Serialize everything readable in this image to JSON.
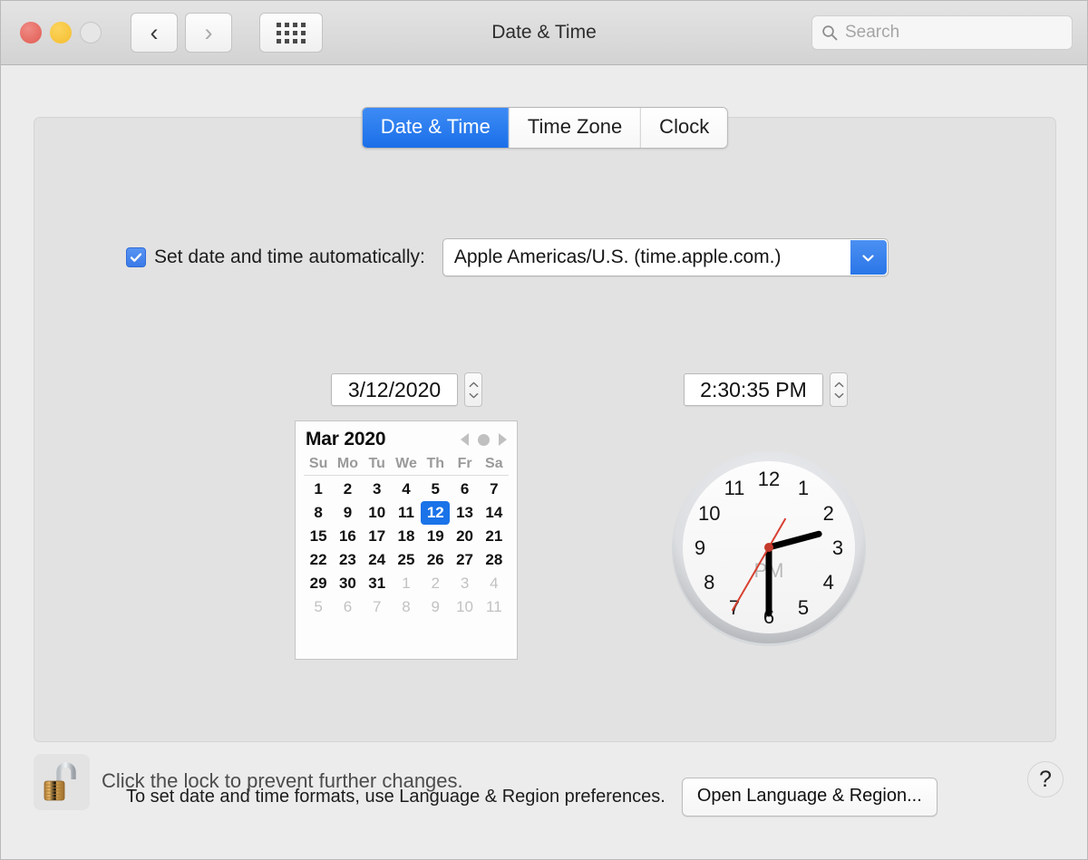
{
  "window": {
    "title": "Date & Time",
    "traffic_lights": [
      "close",
      "minimize",
      "zoom"
    ]
  },
  "toolbar": {
    "back_icon": "chevron-left-icon",
    "forward_icon": "chevron-right-icon",
    "showall_icon": "grid-dots-icon"
  },
  "search": {
    "placeholder": "Search",
    "value": "",
    "icon": "search-icon"
  },
  "tabs": [
    {
      "label": "Date & Time",
      "active": true
    },
    {
      "label": "Time Zone",
      "active": false
    },
    {
      "label": "Clock",
      "active": false
    }
  ],
  "auto_row": {
    "checkbox_checked": true,
    "checkbox_icon": "checkmark-icon",
    "label": "Set date and time automatically:",
    "server": "Apple Americas/U.S. (time.apple.com.)",
    "dropdown_icon": "chevron-down-icon"
  },
  "date_field": {
    "value": "3/12/2020",
    "stepper_up_icon": "stepper-up-icon",
    "stepper_down_icon": "stepper-down-icon"
  },
  "time_field": {
    "value": "2:30:35 PM",
    "stepper_up_icon": "stepper-up-icon",
    "stepper_down_icon": "stepper-down-icon"
  },
  "calendar": {
    "title": "Mar 2020",
    "prev_icon": "triangle-left-icon",
    "today_icon": "circle-dot-icon",
    "next_icon": "triangle-right-icon",
    "weekdays": [
      "Su",
      "Mo",
      "Tu",
      "We",
      "Th",
      "Fr",
      "Sa"
    ],
    "selected_day": 12,
    "weeks": [
      [
        {
          "d": "1",
          "o": false
        },
        {
          "d": "2",
          "o": false
        },
        {
          "d": "3",
          "o": false
        },
        {
          "d": "4",
          "o": false
        },
        {
          "d": "5",
          "o": false
        },
        {
          "d": "6",
          "o": false
        },
        {
          "d": "7",
          "o": false
        }
      ],
      [
        {
          "d": "8",
          "o": false
        },
        {
          "d": "9",
          "o": false
        },
        {
          "d": "10",
          "o": false
        },
        {
          "d": "11",
          "o": false
        },
        {
          "d": "12",
          "o": false,
          "sel": true
        },
        {
          "d": "13",
          "o": false
        },
        {
          "d": "14",
          "o": false
        }
      ],
      [
        {
          "d": "15",
          "o": false
        },
        {
          "d": "16",
          "o": false
        },
        {
          "d": "17",
          "o": false
        },
        {
          "d": "18",
          "o": false
        },
        {
          "d": "19",
          "o": false
        },
        {
          "d": "20",
          "o": false
        },
        {
          "d": "21",
          "o": false
        }
      ],
      [
        {
          "d": "22",
          "o": false
        },
        {
          "d": "23",
          "o": false
        },
        {
          "d": "24",
          "o": false
        },
        {
          "d": "25",
          "o": false
        },
        {
          "d": "26",
          "o": false
        },
        {
          "d": "27",
          "o": false
        },
        {
          "d": "28",
          "o": false
        }
      ],
      [
        {
          "d": "29",
          "o": false
        },
        {
          "d": "30",
          "o": false
        },
        {
          "d": "31",
          "o": false
        },
        {
          "d": "1",
          "o": true
        },
        {
          "d": "2",
          "o": true
        },
        {
          "d": "3",
          "o": true
        },
        {
          "d": "4",
          "o": true
        }
      ],
      [
        {
          "d": "5",
          "o": true
        },
        {
          "d": "6",
          "o": true
        },
        {
          "d": "7",
          "o": true
        },
        {
          "d": "8",
          "o": true
        },
        {
          "d": "9",
          "o": true
        },
        {
          "d": "10",
          "o": true
        },
        {
          "d": "11",
          "o": true
        }
      ]
    ]
  },
  "clock": {
    "hours": [
      "12",
      "1",
      "2",
      "3",
      "4",
      "5",
      "6",
      "7",
      "8",
      "9",
      "10",
      "11"
    ],
    "meridiem": "PM",
    "hour_value": 2,
    "minute_value": 30,
    "second_value": 35,
    "hand_color": "#000000",
    "second_hand_color": "#d84030"
  },
  "note": {
    "text": "To set date and time formats, use Language & Region preferences.",
    "button_label": "Open Language & Region..."
  },
  "lock": {
    "icon": "unlocked-padlock-icon",
    "text": "Click the lock to prevent further changes."
  },
  "help": {
    "label": "?",
    "icon": "question-mark-icon"
  }
}
